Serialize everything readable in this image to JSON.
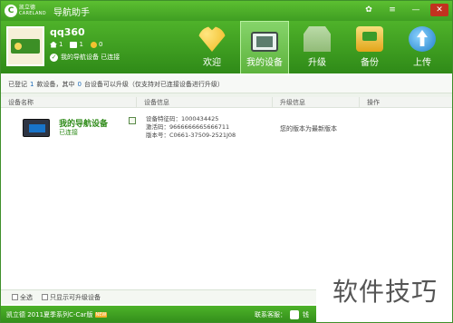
{
  "window": {
    "brand_cn": "凯立德",
    "brand_en": "CARELAND",
    "title": "导航助手",
    "btn_skin": "✿",
    "btn_menu": "≡",
    "btn_min": "—",
    "btn_close": "✕"
  },
  "user": {
    "name": "qq360",
    "stat_home": "1",
    "stat_mail": "1",
    "stat_medal": "0",
    "device_connected": "我的导航设备 已连接"
  },
  "nav": {
    "items": [
      {
        "label": "欢迎",
        "icon": "heart-icon"
      },
      {
        "label": "我的设备",
        "icon": "device-icon"
      },
      {
        "label": "升级",
        "icon": "upgrade-icon"
      },
      {
        "label": "备份",
        "icon": "backup-icon"
      },
      {
        "label": "上传",
        "icon": "upload-icon"
      }
    ]
  },
  "info_strip": {
    "part1": "已登记",
    "part2": "1",
    "part3": "款设备，其中",
    "part4": "0",
    "part5": "台设备可以升级（仅支持对已连接设备进行升级）"
  },
  "table": {
    "headers": [
      "设备名称",
      "设备信息",
      "升级信息",
      "操作"
    ],
    "row": {
      "name": "我的导航设备",
      "status": "已连接",
      "info_line1": "设备特征码：1000434425",
      "info_line2": "激活码：9666666665666711",
      "info_line3": "版本号：C0661-37509-2521J08",
      "upgrade": "您的版本为最新版本"
    }
  },
  "bottom": {
    "select_all": "全选",
    "only_upgradable": "只显示可升级设备"
  },
  "statusbar": {
    "text": "凯立德 2011夏季系列C-Car版",
    "tag": "NEW",
    "contact": "联系客服：",
    "service_name": "钱"
  },
  "watermark": "软件技巧"
}
